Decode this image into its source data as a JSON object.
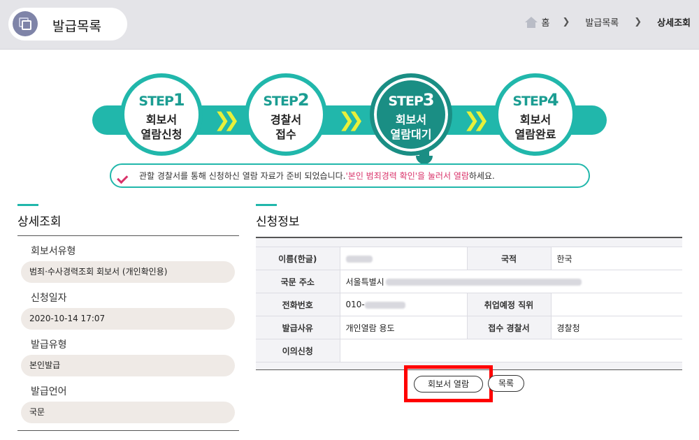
{
  "header": {
    "title": "발급목록",
    "breadcrumb": [
      "홈",
      "발급목록",
      "상세조회"
    ]
  },
  "steps": [
    {
      "label": "STEP",
      "num": "1",
      "text1": "회보서",
      "text2": "열람신청",
      "active": false
    },
    {
      "label": "STEP",
      "num": "2",
      "text1": "경찰서",
      "text2": "접수",
      "active": false
    },
    {
      "label": "STEP",
      "num": "3",
      "text1": "회보서",
      "text2": "열람대기",
      "active": true
    },
    {
      "label": "STEP",
      "num": "4",
      "text1": "회보서",
      "text2": "열람완료",
      "active": false
    }
  ],
  "notice": {
    "prefix": "관할 경찰서를 통해 신청하신 열람 자료가 준비 되었습니다.",
    "highlight": "'본인 범죄경력 확인'을 눌러서 열람",
    "suffix": "하세요."
  },
  "detail": {
    "title": "상세조회",
    "fields": [
      {
        "label": "회보서유형",
        "value": "범죄·수사경력조회 회보서 (개인확인용)"
      },
      {
        "label": "신청일자",
        "value": "2020-10-14 17:07"
      },
      {
        "label": "발급유형",
        "value": "본인발급"
      },
      {
        "label": "발급언어",
        "value": "국문"
      }
    ]
  },
  "info": {
    "title": "신청정보",
    "rows": [
      {
        "h1": "이름(한글)",
        "v1": "",
        "h2": "국적",
        "v2": "한국"
      },
      {
        "h1": "국문 주소",
        "v1": "서울특별시",
        "h2": "",
        "v2": ""
      },
      {
        "h1": "전화번호",
        "v1": "010-",
        "h2": "취업예정 직위",
        "v2": ""
      },
      {
        "h1": "발급사유",
        "v1": "개인열람 용도",
        "h2": "접수 경찰서",
        "v2": "경찰청"
      },
      {
        "h1": "이의신청",
        "v1": "",
        "h2": "",
        "v2": ""
      }
    ]
  },
  "buttons": {
    "open": "회보서 열람",
    "list": "목록"
  },
  "colors": {
    "accent": "#21b7ab",
    "active": "#1a8e84",
    "highlight": "#d9336a",
    "chevron": "#e8f03a",
    "callout": "#ff0000"
  }
}
